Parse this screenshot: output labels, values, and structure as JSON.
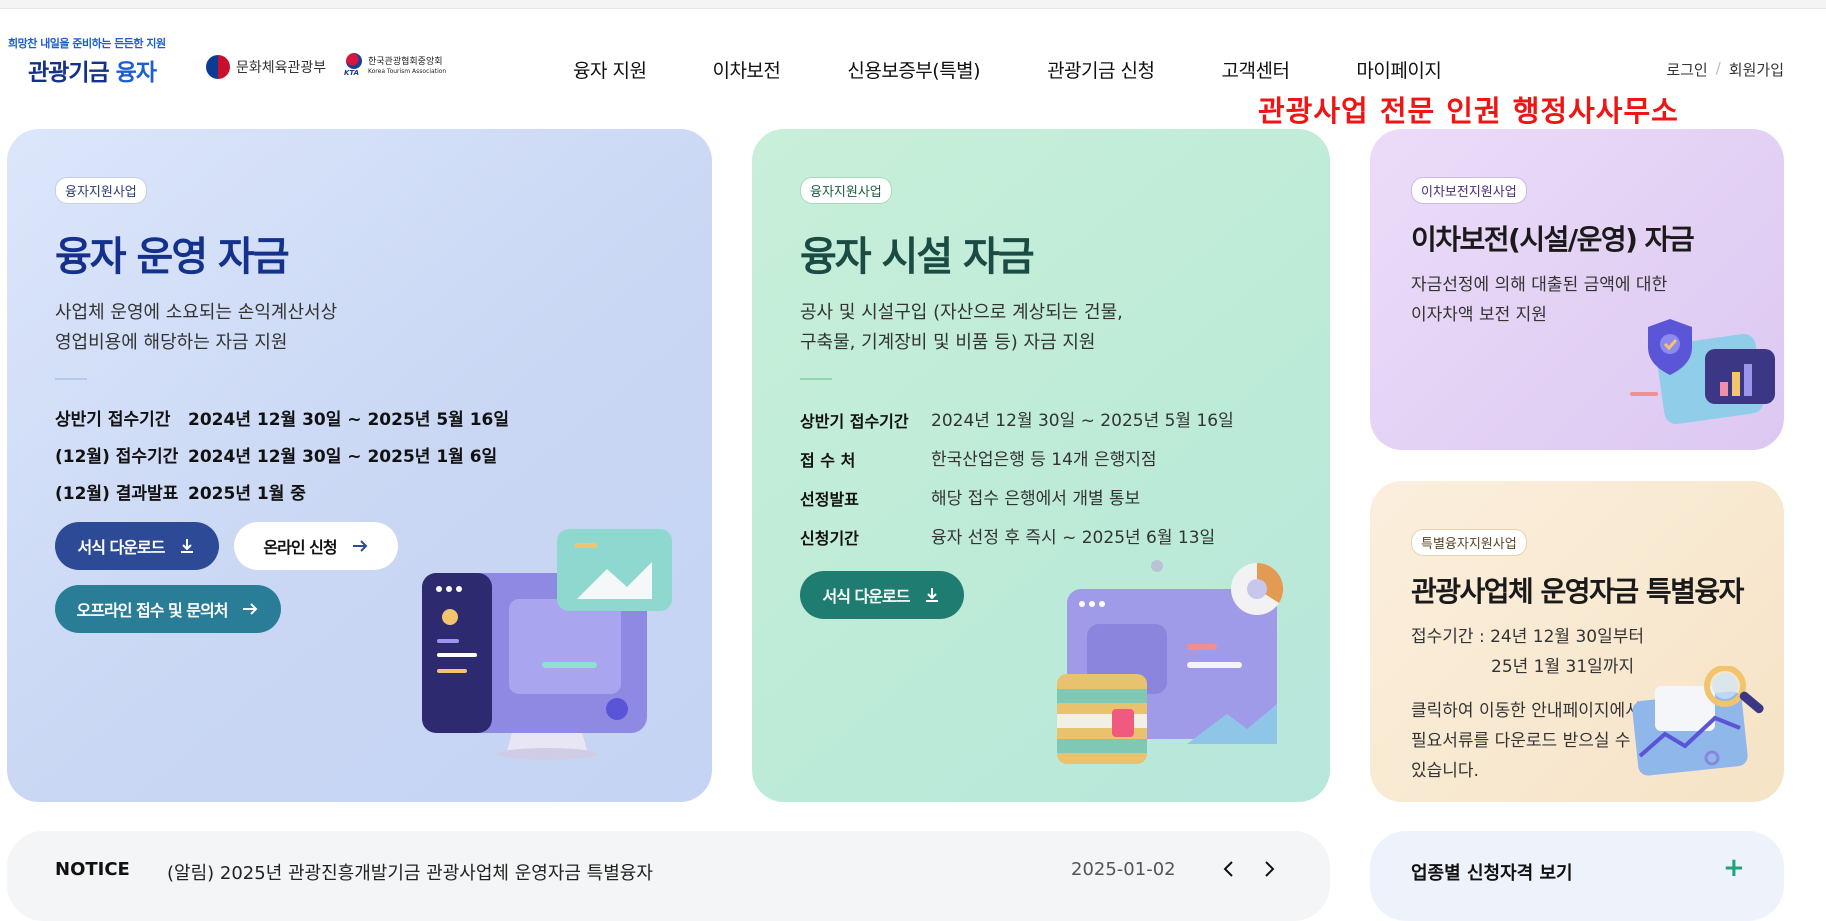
{
  "header": {
    "slogan": "희망찬 내일을 준비하는 든든한 지원",
    "brand_name": "관광기금",
    "brand_name_accent": "융자",
    "ministry": "문화체육관광부",
    "association_kr": "한국관광협회중앙회",
    "association_en": "Korea Tourism Association",
    "nav": [
      "융자 지원",
      "이차보전",
      "신용보증부(특별)",
      "관광기금 신청",
      "고객센터",
      "마이페이지"
    ],
    "login": "로그인",
    "separator": "/",
    "signup": "회원가입"
  },
  "promo_text": "관광사업 전문 인권 행정사사무소",
  "cards": {
    "operating": {
      "badge": "융자지원사업",
      "title": "융자 운영 자금",
      "desc": [
        "사업체 운영에 소요되는 손익계산서상",
        "영업비용에 해당하는 자금 지원"
      ],
      "rows": [
        {
          "k": "상반기 접수기간",
          "v": "2024년 12월 30일 ~ 2025년 5월 16일"
        },
        {
          "k": "(12월) 접수기간",
          "v": "2024년 12월 30일 ~ 2025년 1월 6일"
        },
        {
          "k": "(12월) 결과발표",
          "v": "2025년 1월 중"
        }
      ],
      "btn_download": "서식 다운로드",
      "btn_online": "온라인 신청",
      "btn_offline": "오프라인 접수 및 문의처"
    },
    "facility": {
      "badge": "융자지원사업",
      "title": "융자 시설 자금",
      "desc": [
        "공사 및 시설구입 (자산으로 계상되는 건물,",
        "구축물, 기계장비 및 비품 등) 자금 지원"
      ],
      "rows": [
        {
          "k": "상반기 접수기간",
          "v": "2024년 12월 30일 ~ 2025년 5월 16일"
        },
        {
          "k": "접 수 처",
          "v": "한국산업은행 등 14개 은행지점"
        },
        {
          "k": "선정발표",
          "v": "해당 접수 은행에서 개별 통보"
        },
        {
          "k": "신청기간",
          "v": "융자 선정 후 즉시 ~ 2025년 6월 13일"
        }
      ],
      "btn_download": "서식 다운로드"
    },
    "interest": {
      "badge": "이차보전지원사업",
      "title": "이차보전(시설/운영) 자금",
      "desc": [
        "자금선정에 의해 대출된 금액에 대한",
        "이자차액 보전 지원"
      ]
    },
    "special": {
      "badge": "특별융자지원사업",
      "title": "관광사업체 운영자금 특별융자",
      "period_label": "접수기간 : 24년 12월 30일부터",
      "period_end": "25년 1월 31일까지",
      "desc": [
        "클릭하여 이동한 안내페이지에서",
        "필요서류를 다운로드 받으실 수",
        "있습니다."
      ]
    }
  },
  "notice": {
    "label": "NOTICE",
    "title": "(알림) 2025년 관광진흥개발기금 관광사업체 운영자금 특별융자",
    "date": "2025-01-02"
  },
  "qualification": {
    "label": "업종별 신청자격 보기",
    "plus": "+"
  },
  "colors": {
    "brand_blue": "#14328c",
    "promo_red": "#f01414",
    "btn_navy": "#2c4a95",
    "btn_teal": "#2a7d97",
    "btn_green": "#1f7c70"
  }
}
